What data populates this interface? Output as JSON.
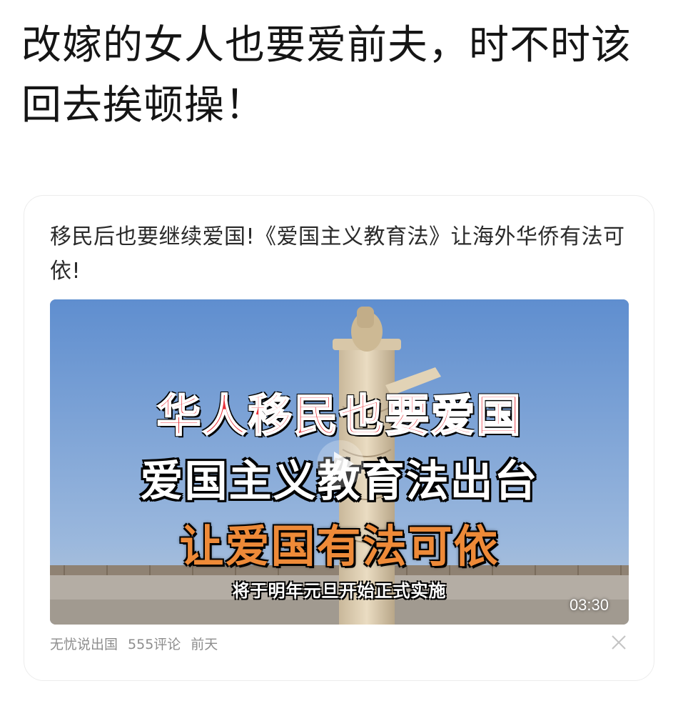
{
  "post": {
    "text": "改嫁的女人也要爱前夫，时不时该回去挨顿操！"
  },
  "card": {
    "title": "移民后也要继续爱国!《爱国主义教育法》让海外华侨有法可依!",
    "video": {
      "overlay_line1": "华人移民也要爱国",
      "overlay_line2": "爱国主义教育法出台",
      "overlay_line3": "让爱国有法可依",
      "overlay_line4": "将于明年元旦开始正式实施",
      "duration": "03:30"
    },
    "meta": {
      "source": "无忧说出国",
      "comments": "555评论",
      "time": "前天"
    }
  }
}
